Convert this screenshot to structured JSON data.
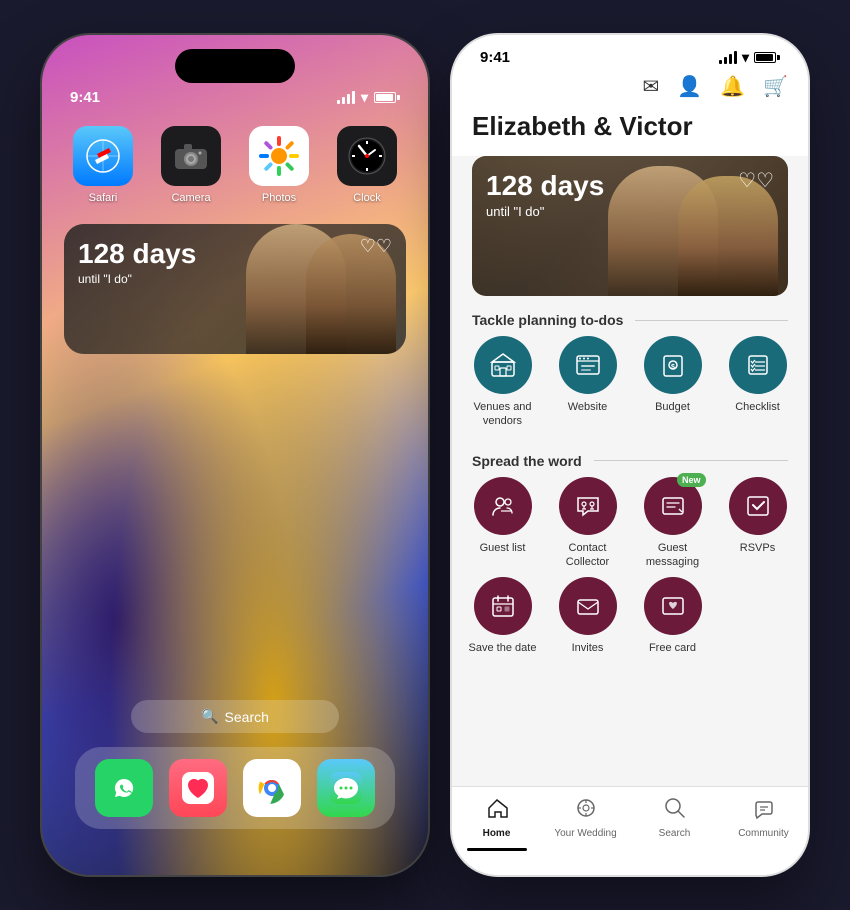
{
  "left_phone": {
    "time": "9:41",
    "apps": [
      {
        "name": "Safari",
        "emoji": "🧭",
        "style": "safari"
      },
      {
        "name": "Camera",
        "emoji": "📷",
        "style": "camera"
      },
      {
        "name": "Photos",
        "emoji": "🌅",
        "style": "photos"
      },
      {
        "name": "Clock",
        "emoji": "🕐",
        "style": "clock"
      }
    ],
    "widget": {
      "days": "128 days",
      "subtitle": "until \"I do\"",
      "hearts": "♡♡"
    },
    "search_label": "Search",
    "dock": [
      {
        "name": "WhatsApp",
        "emoji": "💬",
        "style": "whatsapp"
      },
      {
        "name": "Health",
        "emoji": "❤️",
        "style": "health"
      },
      {
        "name": "Chrome",
        "emoji": "🌐",
        "style": "chrome"
      },
      {
        "name": "Messages",
        "emoji": "💬",
        "style": "imessage"
      }
    ]
  },
  "right_phone": {
    "time": "9:41",
    "title": "Elizabeth & Victor",
    "banner": {
      "days": "128 days",
      "subtitle": "until \"I do\"",
      "hearts": "♡♡"
    },
    "section1": {
      "label": "Tackle planning to-dos",
      "items": [
        {
          "label": "Venues and vendors",
          "icon": "🏛",
          "style": "teal"
        },
        {
          "label": "Website",
          "icon": "🖥",
          "style": "teal"
        },
        {
          "label": "Budget",
          "icon": "💰",
          "style": "teal"
        },
        {
          "label": "Checklist",
          "icon": "✅",
          "style": "teal"
        }
      ]
    },
    "section2": {
      "label": "Spread the word",
      "items": [
        {
          "label": "Guest list",
          "icon": "👥",
          "style": "wine",
          "badge": null
        },
        {
          "label": "Contact Collector",
          "icon": "📬",
          "style": "wine",
          "badge": null
        },
        {
          "label": "Guest messaging",
          "icon": "🎁",
          "style": "wine",
          "badge": "New"
        },
        {
          "label": "RSVPs",
          "icon": "📋",
          "style": "wine",
          "badge": null
        },
        {
          "label": "Save the date",
          "icon": "📅",
          "style": "wine",
          "badge": null
        },
        {
          "label": "Invites",
          "icon": "✉️",
          "style": "wine",
          "badge": null
        },
        {
          "label": "Free card",
          "icon": "💌",
          "style": "wine",
          "badge": null
        }
      ]
    },
    "nav": [
      {
        "label": "Home",
        "icon": "🏠",
        "active": true
      },
      {
        "label": "Your Wedding",
        "icon": "💍",
        "active": false
      },
      {
        "label": "Search",
        "icon": "🔍",
        "active": false
      },
      {
        "label": "Community",
        "icon": "💬",
        "active": false
      }
    ]
  }
}
